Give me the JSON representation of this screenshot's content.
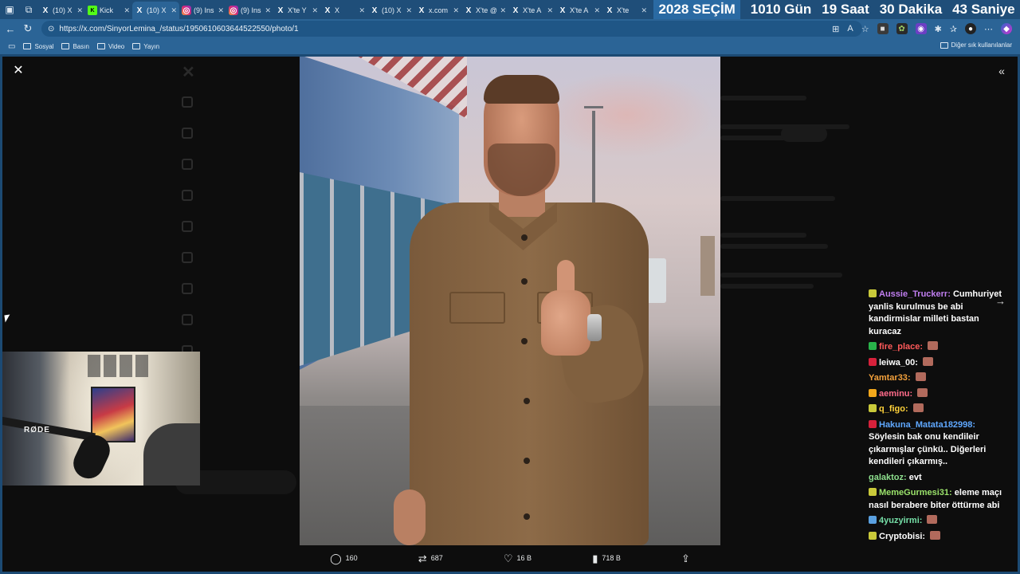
{
  "browser": {
    "tabs": [
      {
        "icon": "x",
        "label": "(10) X"
      },
      {
        "icon": "kick",
        "label": "Kick"
      },
      {
        "icon": "x",
        "label": "(10) X"
      },
      {
        "icon": "ig",
        "label": "(9) Ins"
      },
      {
        "icon": "ig",
        "label": "(9) Ins"
      },
      {
        "icon": "x",
        "label": "X'te Y"
      },
      {
        "icon": "x",
        "label": "X"
      },
      {
        "icon": "x",
        "label": "(10) X"
      },
      {
        "icon": "x",
        "label": "x.com"
      },
      {
        "icon": "x",
        "label": "X'te @"
      },
      {
        "icon": "x",
        "label": "X'te A"
      },
      {
        "icon": "x",
        "label": "X'te A"
      },
      {
        "icon": "x",
        "label": "X'te"
      }
    ],
    "active_tab_index": 2,
    "url": "https://x.com/SinyorLemina_/status/1950610603644522550/photo/1",
    "bookmarks": [
      "Sosyal",
      "Basın",
      "Video",
      "Yayın"
    ],
    "bookmarks_right": "Diğer sık kullanılanlar"
  },
  "countdown": {
    "label": "2028 SEÇİM",
    "days": "1010 Gün",
    "hours": "19 Saat",
    "minutes": "30 Dakika",
    "seconds": "43 Saniye"
  },
  "post_actions": {
    "replies": "160",
    "reposts": "687",
    "likes": "16 B",
    "views": "718 B"
  },
  "chat": {
    "messages": [
      {
        "user": "Aussie_Truckerr",
        "color": "#c07ef0",
        "badge": "#c9c93a",
        "text": "Cumhuriyet yanlis kurulmus be abi kandirmislar milleti bastan kuracaz",
        "emote": false
      },
      {
        "user": "fire_place",
        "color": "#ff5a5a",
        "badge": "#29b34a",
        "text": "",
        "emote": true
      },
      {
        "user": "leiwa_00",
        "color": "#ffffff",
        "badge": "#d6213b",
        "text": "",
        "emote": true
      },
      {
        "user": "Yamtar33",
        "color": "#f3a13c",
        "badge": "",
        "text": "",
        "emote": true
      },
      {
        "user": "aeminu",
        "color": "#ff6b8a",
        "badge": "#f2a71b",
        "text": "",
        "emote": true
      },
      {
        "user": "q_figo",
        "color": "#ffd23a",
        "badge": "#c9c93a",
        "text": "",
        "emote": true
      },
      {
        "user": "Hakuna_Matata182998",
        "color": "#5fa8ff",
        "badge": "#d6213b",
        "text": "Söylesin bak onu kendileir çıkarmışlar çünkü.. Diğerleri kendileri çıkarmış..",
        "emote": false
      },
      {
        "user": "galaktoz",
        "color": "#8ee08e",
        "badge": "",
        "text": "evt",
        "emote": false
      },
      {
        "user": "MemeGurmesi31",
        "color": "#9be36b",
        "badge": "#c9c93a",
        "text": "eleme maçı nasıl berabere biter öttürme abi",
        "emote": false
      },
      {
        "user": "4yuzyirmi",
        "color": "#76e0a8",
        "badge": "#5aa0e0",
        "text": "",
        "emote": true
      },
      {
        "user": "Cryptobisi",
        "color": "#ffffff",
        "badge": "#c9c93a",
        "text": "",
        "emote": true
      }
    ]
  },
  "webcam": {
    "brand": "RØDE"
  }
}
